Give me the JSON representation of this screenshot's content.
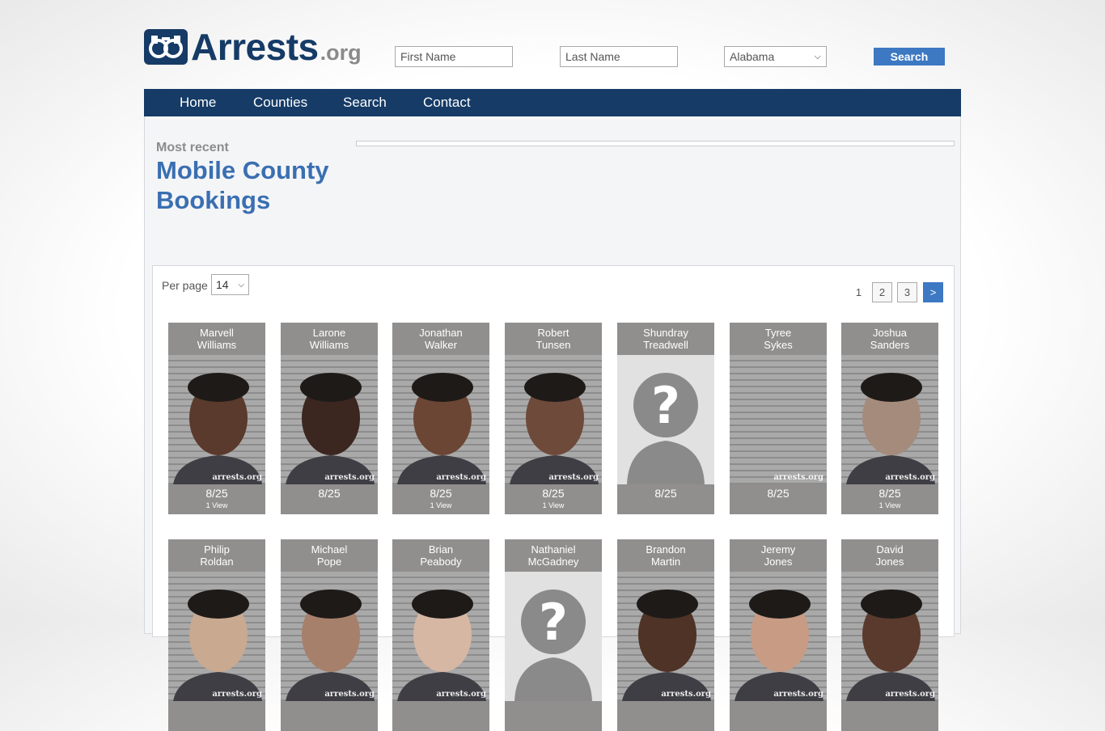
{
  "header": {
    "logo_main": "Arrests",
    "logo_suffix": ".org",
    "first_name_placeholder": "First Name",
    "last_name_placeholder": "Last Name",
    "state_selected": "Alabama",
    "search_label": "Search"
  },
  "nav": {
    "items": [
      "Home",
      "Counties",
      "Search",
      "Contact"
    ]
  },
  "page": {
    "kicker": "Most recent",
    "title": "Mobile County Bookings"
  },
  "listing": {
    "per_page_label": "Per page",
    "per_page_value": "14",
    "pages": [
      "1",
      "2",
      "3",
      ">"
    ],
    "current_page": "1",
    "watermark": "arrests.org",
    "people": [
      {
        "first": "Marvell",
        "last": "Williams",
        "date": "8/25",
        "views": "1 View",
        "photo": "person"
      },
      {
        "first": "Larone",
        "last": "Williams",
        "date": "8/25",
        "views": "",
        "photo": "person"
      },
      {
        "first": "Jonathan",
        "last": "Walker",
        "date": "8/25",
        "views": "1 View",
        "photo": "person"
      },
      {
        "first": "Robert",
        "last": "Tunsen",
        "date": "8/25",
        "views": "1 View",
        "photo": "person"
      },
      {
        "first": "Shundray",
        "last": "Treadwell",
        "date": "8/25",
        "views": "",
        "photo": "placeholder"
      },
      {
        "first": "Tyree",
        "last": "Sykes",
        "date": "8/25",
        "views": "",
        "photo": "empty"
      },
      {
        "first": "Joshua",
        "last": "Sanders",
        "date": "8/25",
        "views": "1 View",
        "photo": "person"
      },
      {
        "first": "Philip",
        "last": "Roldan",
        "date": "",
        "views": "",
        "photo": "person"
      },
      {
        "first": "Michael",
        "last": "Pope",
        "date": "",
        "views": "",
        "photo": "person"
      },
      {
        "first": "Brian",
        "last": "Peabody",
        "date": "",
        "views": "",
        "photo": "person"
      },
      {
        "first": "Nathaniel",
        "last": "McGadney",
        "date": "",
        "views": "",
        "photo": "placeholder"
      },
      {
        "first": "Brandon",
        "last": "Martin",
        "date": "",
        "views": "",
        "photo": "person"
      },
      {
        "first": "Jeremy",
        "last": "Jones",
        "date": "",
        "views": "",
        "photo": "person"
      },
      {
        "first": "David",
        "last": "Jones",
        "date": "",
        "views": "",
        "photo": "person"
      }
    ]
  },
  "colors": {
    "navy": "#153b66",
    "accent_blue": "#3d78c3",
    "card_gray": "#918e8e"
  },
  "icons": [
    "handcuffs-logo-icon",
    "chevron-down-icon",
    "unknown-person-icon"
  ]
}
